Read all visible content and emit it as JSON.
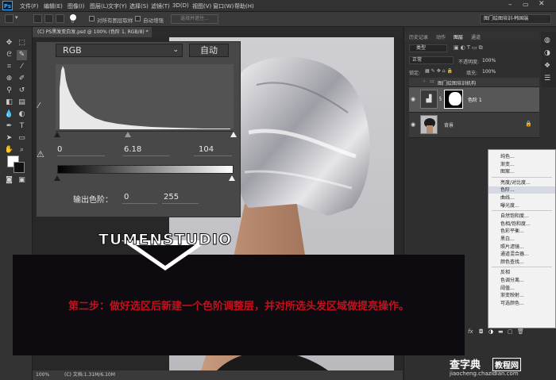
{
  "menubar": {
    "logo": "Ps",
    "items": [
      "文件(F)",
      "编辑(E)",
      "图像(I)",
      "图层(L)",
      "文字(Y)",
      "选择(S)",
      "滤镜(T)",
      "3D(D)",
      "视图(V)",
      "窗口(W)",
      "帮助(H)"
    ]
  },
  "optionsbar": {
    "brush_size": "0",
    "sample_all_layers": "对所有图层取样",
    "auto_enhance": "自动增强",
    "select_and_mask": "选择并遮住...",
    "workspace": "图门绘图培训-韩国端"
  },
  "document": {
    "tab_title": "(C) PS黑发变白发.psd @ 100% (色阶 1, RGB/8) *",
    "zoom": "100%",
    "doc_size": "(C) 文档:1.31M/6.10M"
  },
  "levels": {
    "channel": "RGB",
    "auto_button": "自动",
    "input_black": "0",
    "input_gamma": "6.18",
    "input_white": "104",
    "output_label": "输出色阶：",
    "output_black": "0",
    "output_white": "255"
  },
  "layers_panel": {
    "tabs": [
      "历史记录",
      "动作",
      "图层",
      "通道"
    ],
    "filter_kind": "类型",
    "blend_mode": "正常",
    "opacity_label": "不透明度:",
    "opacity": "100%",
    "lock_label": "锁定:",
    "fill_label": "填充:",
    "fill": "100%",
    "layers": [
      {
        "name": "图门绘图培训机构",
        "type": "group"
      },
      {
        "name": "色阶 1",
        "type": "adjustment"
      },
      {
        "name": "背景",
        "type": "image"
      }
    ],
    "bottom_icons": [
      "fx"
    ]
  },
  "context_menu": {
    "groups": [
      [
        "纯色...",
        "渐变...",
        "图案..."
      ],
      [
        "亮度/对比度...",
        "色阶...",
        "曲线...",
        "曝光度..."
      ],
      [
        "自然饱和度...",
        "色相/饱和度...",
        "色彩平衡...",
        "黑白...",
        "照片滤镜...",
        "通道混合器...",
        "颜色查找..."
      ],
      [
        "反相",
        "色调分离...",
        "阈值...",
        "渐变映射...",
        "可选颜色..."
      ]
    ],
    "highlighted": "色阶..."
  },
  "overlay": {
    "logo_text": "TUMENSTUDIO",
    "caption": "第二步：做好选区后新建一个色阶调整层，并对所选头发区域做提亮操作。"
  },
  "watermark": {
    "title": "查字典",
    "sub": "教程网",
    "url": "jiaocheng.chazidian.com"
  }
}
